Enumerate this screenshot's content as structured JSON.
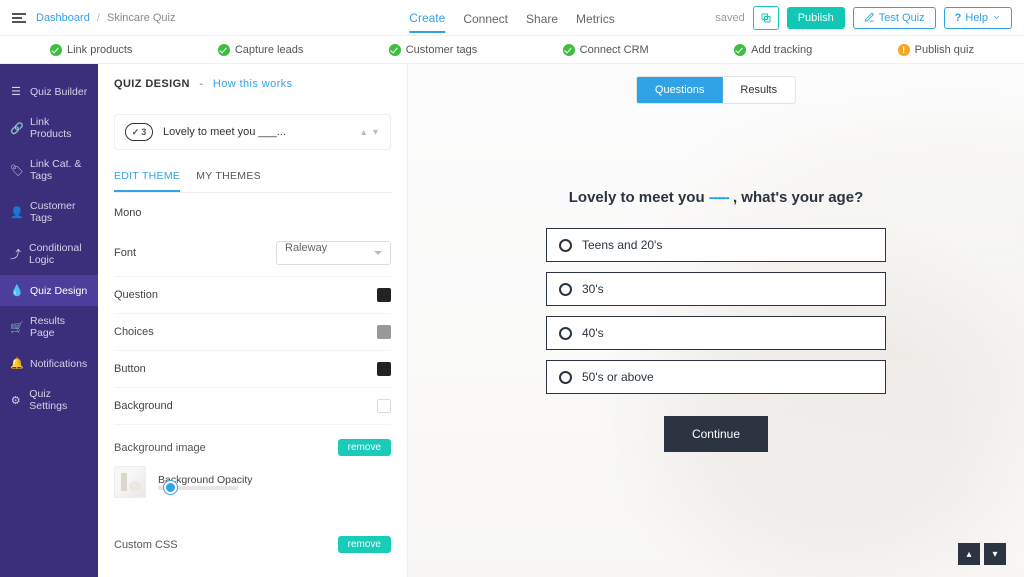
{
  "top": {
    "breadcrumb_root": "Dashboard",
    "breadcrumb_current": "Skincare Quiz",
    "tabs": {
      "create": "Create",
      "connect": "Connect",
      "share": "Share",
      "metrics": "Metrics"
    },
    "saved": "saved",
    "publish": "Publish",
    "test": "Test Quiz",
    "help": "Help"
  },
  "steps": {
    "s1": "Link products",
    "s2": "Capture leads",
    "s3": "Customer tags",
    "s4": "Connect CRM",
    "s5": "Add tracking",
    "s6": "Publish quiz"
  },
  "sidebar": {
    "items": [
      {
        "icon": "list",
        "label": "Quiz Builder"
      },
      {
        "icon": "link",
        "label": "Link Products"
      },
      {
        "icon": "tag",
        "label": "Link Cat. & Tags"
      },
      {
        "icon": "user",
        "label": "Customer Tags"
      },
      {
        "icon": "branch",
        "label": "Conditional Logic"
      },
      {
        "icon": "drop",
        "label": "Quiz Design"
      },
      {
        "icon": "cart",
        "label": "Results Page"
      },
      {
        "icon": "bell",
        "label": "Notifications"
      },
      {
        "icon": "gear",
        "label": "Quiz Settings"
      }
    ],
    "active_index": 5
  },
  "panel": {
    "heading": "QUIZ DESIGN",
    "how": "How this works",
    "question_number": "3",
    "question_title": "Lovely to meet you ___...",
    "tabs": {
      "edit": "EDIT THEME",
      "my": "MY THEMES"
    },
    "theme_name": "Mono",
    "rows": {
      "font_label": "Font",
      "font_value": "Raleway",
      "question": "Question",
      "choices": "Choices",
      "button": "Button",
      "background": "Background",
      "bgimg_label": "Background image",
      "remove": "remove",
      "opacity_label": "Background Opacity",
      "css_label": "Custom CSS"
    },
    "colors": {
      "question": "#222222",
      "choices": "#8f8f8f",
      "button": "#222222",
      "background": "#ffffff"
    }
  },
  "preview": {
    "tabs": {
      "questions": "Questions",
      "results": "Results"
    },
    "question_pre": "Lovely to meet you ",
    "question_blank": "-----",
    "question_post": " , what's your age?",
    "options": [
      "Teens and 20's",
      "30's",
      "40's",
      "50's or above"
    ],
    "continue": "Continue"
  }
}
